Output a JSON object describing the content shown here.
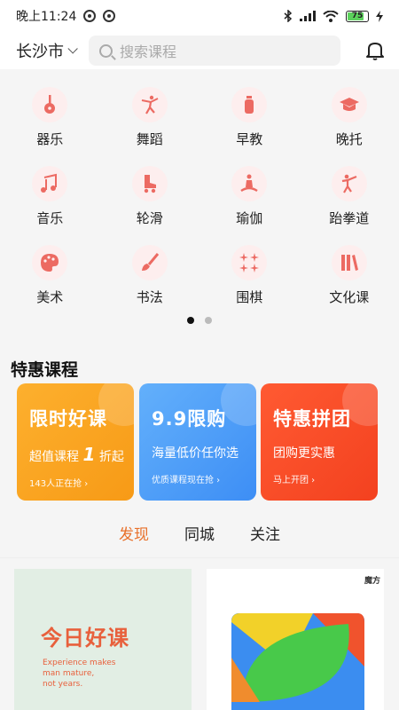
{
  "status": {
    "time": "晚上11:24",
    "battery": "75",
    "battery_level": 0.75
  },
  "header": {
    "city": "长沙市",
    "search_placeholder": "搜索课程"
  },
  "categories": [
    {
      "label": "器乐",
      "icon": "guitar-icon"
    },
    {
      "label": "舞蹈",
      "icon": "dancer-icon"
    },
    {
      "label": "早教",
      "icon": "bottle-icon"
    },
    {
      "label": "晚托",
      "icon": "graduation-cap-icon"
    },
    {
      "label": "音乐",
      "icon": "music-note-icon"
    },
    {
      "label": "轮滑",
      "icon": "roller-skate-icon"
    },
    {
      "label": "瑜伽",
      "icon": "yoga-icon"
    },
    {
      "label": "跆拳道",
      "icon": "martial-arts-icon"
    },
    {
      "label": "美术",
      "icon": "palette-icon"
    },
    {
      "label": "书法",
      "icon": "brush-icon"
    },
    {
      "label": "围棋",
      "icon": "go-board-icon"
    },
    {
      "label": "文化课",
      "icon": "books-icon"
    }
  ],
  "pager": {
    "pages": 2,
    "active": 0
  },
  "specials": {
    "title": "特惠课程",
    "cards": [
      {
        "title": "限时好课",
        "sub_prefix": "超值课程",
        "sub_big": "1",
        "sub_suffix": "折起",
        "note": "143人正在抢 ›",
        "color_from": "#fdb02e",
        "color_to": "#f79a16"
      },
      {
        "title": "9.9限购",
        "sub_prefix": "海量低价任你选",
        "sub_big": "",
        "sub_suffix": "",
        "note": "优质课程现在抢 ›",
        "color_from": "#63b0fb",
        "color_to": "#3d8ef5"
      },
      {
        "title": "特惠拼团",
        "sub_prefix": "团购更实惠",
        "sub_big": "",
        "sub_suffix": "",
        "note": "马上开团 ›",
        "color_from": "#ff5a32",
        "color_to": "#f3411f"
      }
    ]
  },
  "tabs": [
    {
      "label": "发现",
      "active": true
    },
    {
      "label": "同城",
      "active": false
    },
    {
      "label": "关注",
      "active": false
    }
  ],
  "feed": {
    "left": {
      "title": "今日好课",
      "en_lines": [
        "Experience makes",
        "man mature,",
        "not years."
      ]
    },
    "right": {
      "logo": "魔方"
    }
  },
  "colors": {
    "accent": "#e8702a",
    "icon": "#ec6a62"
  }
}
